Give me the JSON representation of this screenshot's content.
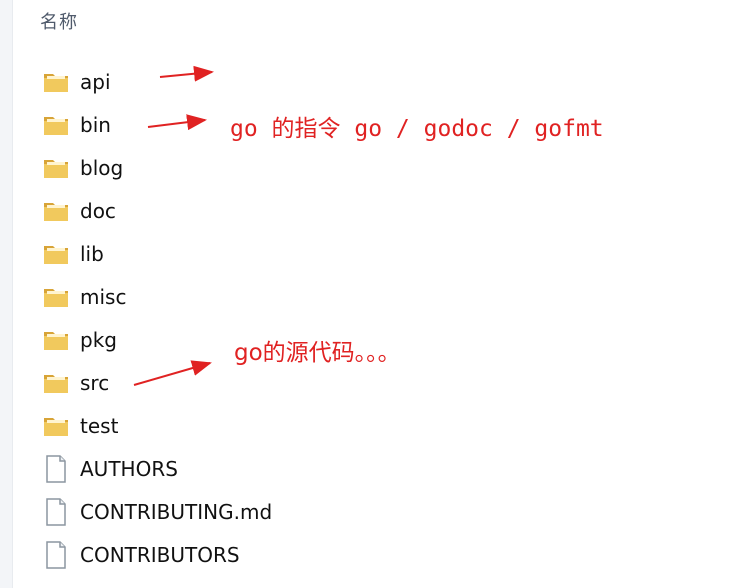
{
  "header": {
    "name_column": "名称"
  },
  "files": [
    {
      "name": "api",
      "type": "folder",
      "icon": "folder-icon"
    },
    {
      "name": "bin",
      "type": "folder",
      "icon": "folder-icon"
    },
    {
      "name": "blog",
      "type": "folder",
      "icon": "folder-icon"
    },
    {
      "name": "doc",
      "type": "folder",
      "icon": "folder-icon"
    },
    {
      "name": "lib",
      "type": "folder",
      "icon": "folder-icon"
    },
    {
      "name": "misc",
      "type": "folder",
      "icon": "folder-icon"
    },
    {
      "name": "pkg",
      "type": "folder",
      "icon": "folder-icon"
    },
    {
      "name": "src",
      "type": "folder",
      "icon": "folder-icon"
    },
    {
      "name": "test",
      "type": "folder",
      "icon": "folder-icon"
    },
    {
      "name": "AUTHORS",
      "type": "file",
      "icon": "file-icon"
    },
    {
      "name": "CONTRIBUTING.md",
      "type": "file",
      "icon": "file-icon"
    },
    {
      "name": "CONTRIBUTORS",
      "type": "file",
      "icon": "file-icon"
    }
  ],
  "annotations": {
    "bin_note": "go 的指令 go / godoc / gofmt",
    "src_note": "go的源代码。。。"
  },
  "colors": {
    "annotation": "#e02222",
    "folder": "#e8b94a",
    "header_text": "#4f5a6b"
  }
}
